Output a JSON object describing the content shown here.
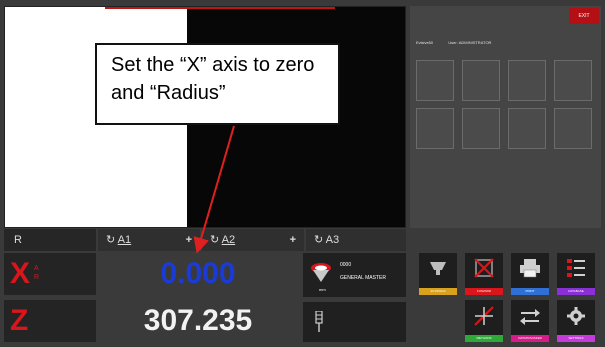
{
  "callout": {
    "text": "Set the “X” axis to zero and “Radius”"
  },
  "header": {
    "exit_label": "EXIT",
    "device": "Evisive50",
    "user": "User: ADMINISTRATOR"
  },
  "axes_header": {
    "mode": "R",
    "a1": "A1",
    "a2": "A2",
    "a3": "A3"
  },
  "rows": [
    {
      "axis": "X",
      "sub_top": "A",
      "sub_bot": "R",
      "value": "0.000",
      "color": "#1a3bd6"
    },
    {
      "axis": "Z",
      "value": "307.235",
      "color": "#f2f2f2"
    }
  ],
  "master": {
    "code": "0000",
    "name": "GENERAL MASTER",
    "sub": "mm"
  },
  "function_buttons": [
    {
      "label": "20 PROGS",
      "color": "#d8a21c"
    },
    {
      "label": "FUNZIONI",
      "color": "#d8161c"
    },
    {
      "label": "PRINT",
      "color": "#2f6fd6"
    },
    {
      "label": "DATABASE",
      "color": "#8b2fd6"
    },
    {
      "label": "METHODS",
      "color": "#2fa83a"
    },
    {
      "label": "DATATRANSFER",
      "color": "#d61c88"
    },
    {
      "label": "SETTINGS",
      "color": "#c43adb"
    }
  ]
}
